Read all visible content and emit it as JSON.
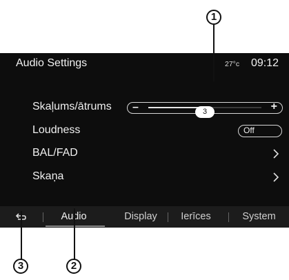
{
  "header": {
    "title": "Audio Settings",
    "temperature": "27°c",
    "time": "09:12"
  },
  "settings": {
    "volume": {
      "label": "Skaļums/ātrums",
      "minus": "–",
      "plus": "+",
      "value": "3",
      "level": 0.5
    },
    "loudness": {
      "label": "Loudness",
      "state": "Off"
    },
    "balfad": {
      "label": "BAL/FAD",
      "icon": "chevron-right-icon"
    },
    "sound": {
      "label": "Skaņa",
      "icon": "chevron-right-icon"
    }
  },
  "tabs": {
    "back_icon": "back-arrow-icon",
    "items": [
      {
        "label": "Audio",
        "active": true
      },
      {
        "label": "Display",
        "active": false
      },
      {
        "label": "Ierīces",
        "active": false
      },
      {
        "label": "System",
        "active": false
      }
    ]
  },
  "callouts": {
    "one": "1",
    "two": "2",
    "three": "3"
  }
}
